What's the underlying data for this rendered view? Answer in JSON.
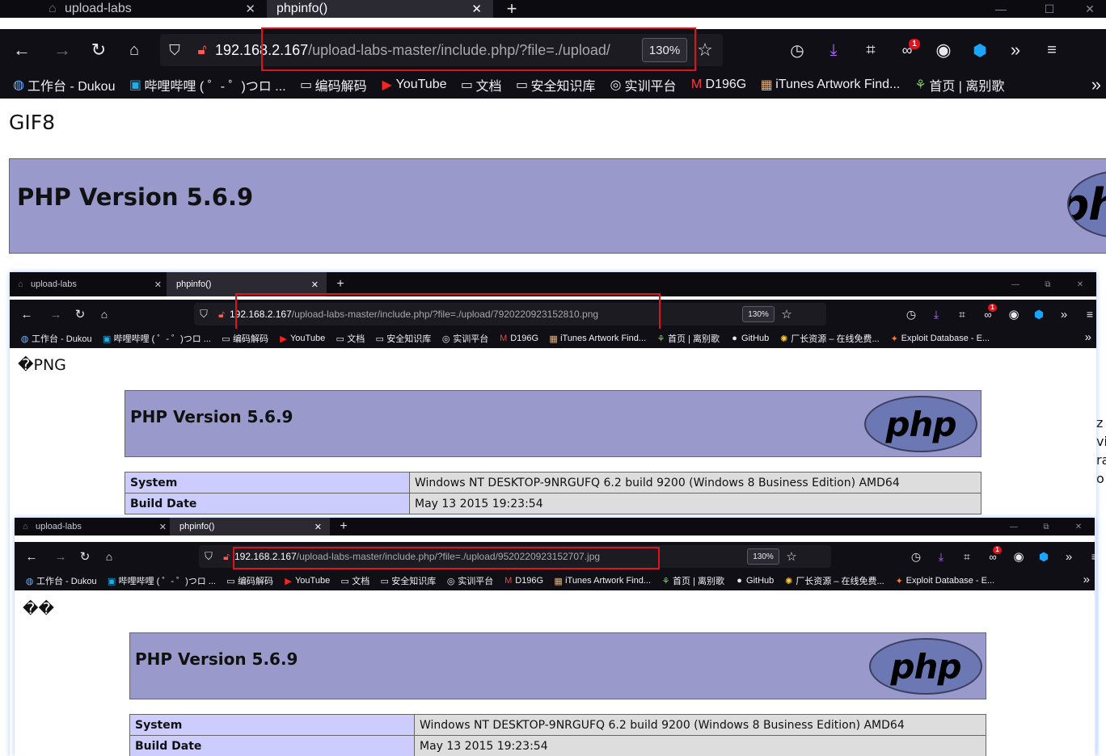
{
  "php": {
    "version_title": "PHP Version 5.6.9",
    "logo_text": "php",
    "rows": [
      {
        "label": "System",
        "value": "Windows NT DESKTOP-9NRGUFQ 6.2 build 9200 (Windows 8 Business Edition) AMD64"
      },
      {
        "label": "Build Date",
        "value": "May 13 2015 19:23:54"
      }
    ],
    "brand_color": "#9999cc"
  },
  "windows": [
    {
      "tabs": [
        {
          "title": "upload-labs"
        },
        {
          "title": "phpinfo()"
        }
      ],
      "url_host": "192.168.2.167",
      "url_path": "/upload-labs-master/include.php/?file=./upload/",
      "zoom": "130%",
      "badge": "1",
      "page_heading": "GIF8",
      "bookmarks": [
        {
          "label": "工作台 - Dukou",
          "icon": "globe-icon"
        },
        {
          "label": "哔哩哔哩 ( ゜- ゜)つロ ...",
          "icon": "bilibili-icon"
        },
        {
          "label": "编码解码",
          "icon": "folder-icon"
        },
        {
          "label": "YouTube",
          "icon": "youtube-icon"
        },
        {
          "label": "文档",
          "icon": "folder-icon"
        },
        {
          "label": "安全知识库",
          "icon": "folder-icon"
        },
        {
          "label": "实训平台",
          "icon": "target-icon"
        },
        {
          "label": "D196G",
          "icon": "m-icon"
        },
        {
          "label": "iTunes Artwork Find...",
          "icon": "avatar-icon"
        },
        {
          "label": "首页 | 离别歌",
          "icon": "plant-icon"
        }
      ]
    },
    {
      "tabs": [
        {
          "title": "upload-labs"
        },
        {
          "title": "phpinfo()"
        }
      ],
      "url_host": "192.168.2.167",
      "url_path": "/upload-labs-master/include.php/?file=./upload/7920220923152810.png",
      "zoom": "130%",
      "badge": "1",
      "page_heading": "�PNG",
      "bookmarks": [
        {
          "label": "工作台 - Dukou",
          "icon": "globe-icon"
        },
        {
          "label": "哔哩哔哩 ( ゜- ゜)つロ ...",
          "icon": "bilibili-icon"
        },
        {
          "label": "编码解码",
          "icon": "folder-icon"
        },
        {
          "label": "YouTube",
          "icon": "youtube-icon"
        },
        {
          "label": "文档",
          "icon": "folder-icon"
        },
        {
          "label": "安全知识库",
          "icon": "folder-icon"
        },
        {
          "label": "实训平台",
          "icon": "target-icon"
        },
        {
          "label": "D196G",
          "icon": "m-icon"
        },
        {
          "label": "iTunes Artwork Find...",
          "icon": "avatar-icon"
        },
        {
          "label": "首页 | 离别歌",
          "icon": "plant-icon"
        },
        {
          "label": "GitHub",
          "icon": "github-icon"
        },
        {
          "label": "厂长资源 – 在线免费...",
          "icon": "sun-icon"
        },
        {
          "label": "Exploit Database - E...",
          "icon": "exploit-icon"
        }
      ]
    },
    {
      "tabs": [
        {
          "title": "upload-labs"
        },
        {
          "title": "phpinfo()"
        }
      ],
      "url_host": "192.168.2.167",
      "url_path": "/upload-labs-master/include.php/?file=./upload/9520220923152707.jpg",
      "zoom": "130%",
      "badge": "1",
      "page_heading": "��",
      "bookmarks": [
        {
          "label": "工作台 - Dukou",
          "icon": "globe-icon"
        },
        {
          "label": "哔哩哔哩 ( ゜- ゜)つロ ...",
          "icon": "bilibili-icon"
        },
        {
          "label": "编码解码",
          "icon": "folder-icon"
        },
        {
          "label": "YouTube",
          "icon": "youtube-icon"
        },
        {
          "label": "文档",
          "icon": "folder-icon"
        },
        {
          "label": "安全知识库",
          "icon": "folder-icon"
        },
        {
          "label": "实训平台",
          "icon": "target-icon"
        },
        {
          "label": "D196G",
          "icon": "m-icon"
        },
        {
          "label": "iTunes Artwork Find...",
          "icon": "avatar-icon"
        },
        {
          "label": "首页 | 离别歌",
          "icon": "plant-icon"
        },
        {
          "label": "GitHub",
          "icon": "github-icon"
        },
        {
          "label": "厂长资源 – 在线免费...",
          "icon": "sun-icon"
        },
        {
          "label": "Exploit Database - E...",
          "icon": "exploit-icon"
        }
      ]
    }
  ],
  "side_fragment": [
    "z",
    "vi",
    "ra",
    "o"
  ],
  "highlight_color": "#e0121b"
}
